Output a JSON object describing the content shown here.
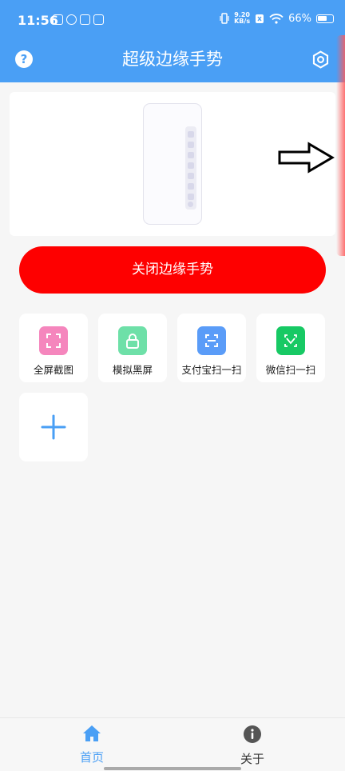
{
  "status_bar": {
    "time": "11:56",
    "net_speed_value": "9.20",
    "net_speed_unit": "KB/s",
    "battery": "66%",
    "battery_level": 0.66
  },
  "app_bar": {
    "title": "超级边缘手势",
    "help_glyph": "?",
    "help_icon": "help-icon",
    "settings_icon": "settings-icon"
  },
  "main_button": {
    "label": "关闭边缘手势",
    "color": "#fe0000"
  },
  "shortcuts": [
    {
      "label": "全屏截图",
      "icon": "screenshot-icon",
      "color": "#f586bd"
    },
    {
      "label": "模拟黑屏",
      "icon": "lock-icon",
      "color": "#6ee0a8"
    },
    {
      "label": "支付宝扫一扫",
      "icon": "scan-icon",
      "color": "#5a9cf8"
    },
    {
      "label": "微信扫一扫",
      "icon": "scan-frame-icon",
      "color": "#17c964"
    }
  ],
  "bottom_nav": [
    {
      "label": "首页",
      "icon": "home-icon",
      "active": true,
      "color": "#4a9ff5"
    },
    {
      "label": "关于",
      "icon": "info-icon",
      "active": false,
      "color": "#333333"
    }
  ],
  "colors": {
    "primary": "#4a9ff5",
    "background": "#f6f6f6"
  }
}
